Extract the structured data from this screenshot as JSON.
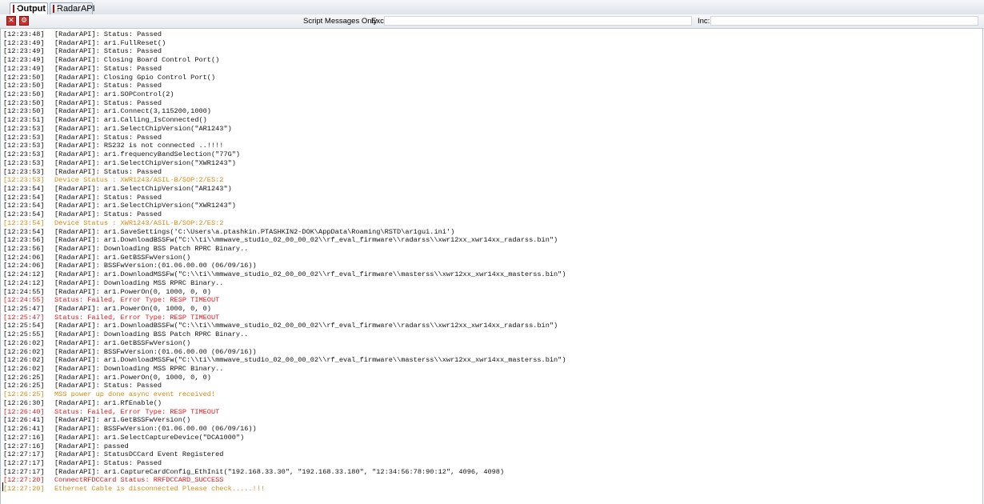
{
  "tabs": [
    {
      "label": "Output",
      "active": true,
      "icon": "output-icon"
    },
    {
      "label": "RadarAPI",
      "active": false,
      "icon": "radarapi-icon"
    }
  ],
  "toolbar": {
    "buttons": [
      "clear-icon",
      "settings-icon"
    ],
    "script_messages_only": "Script Messages Only",
    "exc_label": "Exc:",
    "exc_value": "",
    "inc_label": "Inc:",
    "inc_value": ""
  },
  "colors": {
    "normal": "#111111",
    "device_status": "#d48a12",
    "error": "#e01818"
  },
  "log": [
    {
      "time": "[12:23:48]",
      "msg": "[RadarAPI]: Status: Passed",
      "level": "normal"
    },
    {
      "time": "[12:23:49]",
      "msg": "[RadarAPI]: ar1.FullReset()",
      "level": "normal"
    },
    {
      "time": "[12:23:49]",
      "msg": "[RadarAPI]: Status: Passed",
      "level": "normal"
    },
    {
      "time": "[12:23:49]",
      "msg": "[RadarAPI]: Closing Board Control Port()",
      "level": "normal"
    },
    {
      "time": "[12:23:49]",
      "msg": "[RadarAPI]: Status: Passed",
      "level": "normal"
    },
    {
      "time": "[12:23:50]",
      "msg": "[RadarAPI]: Closing Gpio Control Port()",
      "level": "normal"
    },
    {
      "time": "[12:23:50]",
      "msg": "[RadarAPI]: Status: Passed",
      "level": "normal"
    },
    {
      "time": "[12:23:50]",
      "msg": "[RadarAPI]: ar1.SOPControl(2)",
      "level": "normal"
    },
    {
      "time": "[12:23:50]",
      "msg": "[RadarAPI]: Status: Passed",
      "level": "normal"
    },
    {
      "time": "[12:23:50]",
      "msg": "[RadarAPI]: ar1.Connect(3,115200,1000)",
      "level": "normal"
    },
    {
      "time": "[12:23:51]",
      "msg": "[RadarAPI]: ar1.Calling_IsConnected()",
      "level": "normal"
    },
    {
      "time": "[12:23:53]",
      "msg": "[RadarAPI]: ar1.SelectChipVersion(\"AR1243\")",
      "level": "normal"
    },
    {
      "time": "[12:23:53]",
      "msg": "[RadarAPI]: Status: Passed",
      "level": "normal"
    },
    {
      "time": "[12:23:53]",
      "msg": "[RadarAPI]: RS232 is not connected ..!!!!",
      "level": "normal"
    },
    {
      "time": "[12:23:53]",
      "msg": "[RadarAPI]: ar1.frequencyBandSelection(\"77G\")",
      "level": "normal"
    },
    {
      "time": "[12:23:53]",
      "msg": "[RadarAPI]: ar1.SelectChipVersion(\"XWR1243\")",
      "level": "normal"
    },
    {
      "time": "[12:23:53]",
      "msg": "[RadarAPI]: Status: Passed",
      "level": "normal"
    },
    {
      "time": "[12:23:53]",
      "msg": "Device Status : XWR1243/ASIL-B/SOP:2/ES:2",
      "level": "orange"
    },
    {
      "time": "[12:23:54]",
      "msg": "[RadarAPI]: ar1.SelectChipVersion(\"AR1243\")",
      "level": "normal"
    },
    {
      "time": "[12:23:54]",
      "msg": "[RadarAPI]: Status: Passed",
      "level": "normal"
    },
    {
      "time": "[12:23:54]",
      "msg": "[RadarAPI]: ar1.SelectChipVersion(\"XWR1243\")",
      "level": "normal"
    },
    {
      "time": "[12:23:54]",
      "msg": "[RadarAPI]: Status: Passed",
      "level": "normal"
    },
    {
      "time": "[12:23:54]",
      "msg": "Device Status : XWR1243/ASIL-B/SOP:2/ES:2",
      "level": "orange"
    },
    {
      "time": "[12:23:54]",
      "msg": "[RadarAPI]: ar1.SaveSettings('C:\\Users\\a.ptashkin.PTASHKIN2-DOK\\AppData\\Roaming\\RSTD\\ar1gui.ini')",
      "level": "normal"
    },
    {
      "time": "[12:23:56]",
      "msg": "[RadarAPI]: ar1.DownloadBSSFw(\"C:\\\\ti\\\\mmwave_studio_02_00_00_02\\\\rf_eval_firmware\\\\radarss\\\\xwr12xx_xwr14xx_radarss.bin\")",
      "level": "normal"
    },
    {
      "time": "[12:23:56]",
      "msg": "[RadarAPI]: Downloading BSS Patch RPRC Binary..",
      "level": "normal"
    },
    {
      "time": "[12:24:06]",
      "msg": "[RadarAPI]: ar1.GetBSSFwVersion()",
      "level": "normal"
    },
    {
      "time": "[12:24:06]",
      "msg": "[RadarAPI]: BSSFwVersion:(01.06.00.00 (06/09/16))",
      "level": "normal"
    },
    {
      "time": "[12:24:12]",
      "msg": "[RadarAPI]: ar1.DownloadMSSFw(\"C:\\\\ti\\\\mmwave_studio_02_00_00_02\\\\rf_eval_firmware\\\\masterss\\\\xwr12xx_xwr14xx_masterss.bin\")",
      "level": "normal"
    },
    {
      "time": "[12:24:12]",
      "msg": "[RadarAPI]: Downloading MSS RPRC Binary..",
      "level": "normal"
    },
    {
      "time": "[12:24:55]",
      "msg": "[RadarAPI]: ar1.PowerOn(0, 1000, 0, 0)",
      "level": "normal"
    },
    {
      "time": "[12:24:55]",
      "msg": "Status: Failed, Error Type: RESP TIMEOUT",
      "level": "red"
    },
    {
      "time": "[12:25:47]",
      "msg": "[RadarAPI]: ar1.PowerOn(0, 1000, 0, 0)",
      "level": "normal"
    },
    {
      "time": "[12:25:47]",
      "msg": "Status: Failed, Error Type: RESP TIMEOUT",
      "level": "red"
    },
    {
      "time": "[12:25:54]",
      "msg": "[RadarAPI]: ar1.DownloadBSSFw(\"C:\\\\ti\\\\mmwave_studio_02_00_00_02\\\\rf_eval_firmware\\\\radarss\\\\xwr12xx_xwr14xx_radarss.bin\")",
      "level": "normal"
    },
    {
      "time": "[12:25:55]",
      "msg": "[RadarAPI]: Downloading BSS Patch RPRC Binary..",
      "level": "normal"
    },
    {
      "time": "[12:26:02]",
      "msg": "[RadarAPI]: ar1.GetBSSFwVersion()",
      "level": "normal"
    },
    {
      "time": "[12:26:02]",
      "msg": "[RadarAPI]: BSSFwVersion:(01.06.00.00 (06/09/16))",
      "level": "normal"
    },
    {
      "time": "[12:26:02]",
      "msg": "[RadarAPI]: ar1.DownloadMSSFw(\"C:\\\\ti\\\\mmwave_studio_02_00_00_02\\\\rf_eval_firmware\\\\masterss\\\\xwr12xx_xwr14xx_masterss.bin\")",
      "level": "normal"
    },
    {
      "time": "[12:26:02]",
      "msg": "[RadarAPI]: Downloading MSS RPRC Binary..",
      "level": "normal"
    },
    {
      "time": "[12:26:25]",
      "msg": "[RadarAPI]: ar1.PowerOn(0, 1000, 0, 0)",
      "level": "normal"
    },
    {
      "time": "[12:26:25]",
      "msg": "[RadarAPI]: Status: Passed",
      "level": "normal"
    },
    {
      "time": "[12:26:25]",
      "msg": "MSS power up done async event received!",
      "level": "orange"
    },
    {
      "time": "[12:26:30]",
      "msg": "[RadarAPI]: ar1.RfEnable()",
      "level": "normal"
    },
    {
      "time": "[12:26:40]",
      "msg": "Status: Failed, Error Type: RESP TIMEOUT",
      "level": "red"
    },
    {
      "time": "[12:26:41]",
      "msg": "[RadarAPI]: ar1.GetBSSFwVersion()",
      "level": "normal"
    },
    {
      "time": "[12:26:41]",
      "msg": "[RadarAPI]: BSSFwVersion:(01.06.00.00 (06/09/16))",
      "level": "normal"
    },
    {
      "time": "[12:27:16]",
      "msg": "[RadarAPI]: ar1.SelectCaptureDevice(\"DCA1000\")",
      "level": "normal"
    },
    {
      "time": "[12:27:16]",
      "msg": "[RadarAPI]: passed",
      "level": "normal"
    },
    {
      "time": "[12:27:17]",
      "msg": "[RadarAPI]: StatusDCCard Event Registered",
      "level": "normal"
    },
    {
      "time": "[12:27:17]",
      "msg": "[RadarAPI]: Status: Passed",
      "level": "normal"
    },
    {
      "time": "[12:27:17]",
      "msg": "[RadarAPI]: ar1.CaptureCardConfig_EthInit(\"192.168.33.30\", \"192.168.33.180\", \"12:34:56:78:90:12\", 4096, 4098)",
      "level": "normal"
    },
    {
      "time": "[12:27:20]",
      "msg": "ConnectRFDCCard Status: RRFDCCARD_SUCCESS",
      "level": "red"
    },
    {
      "time": "[12:27:20]",
      "msg": "Ethernet Cable is disconnected Please check.....!!!",
      "level": "orange"
    }
  ]
}
